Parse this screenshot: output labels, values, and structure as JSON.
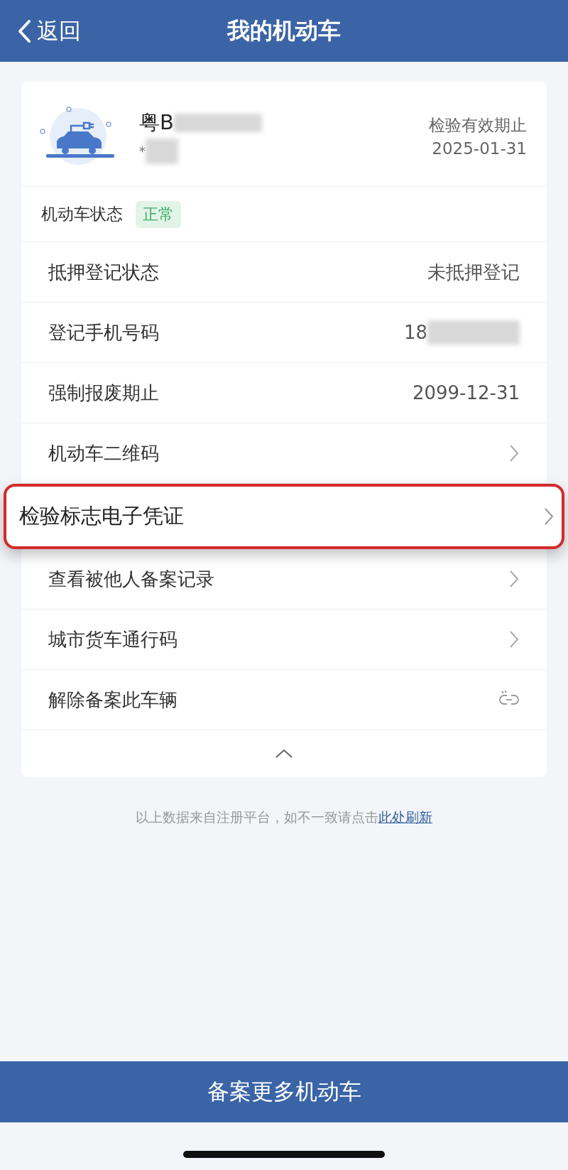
{
  "nav_bar": {
    "back": "返回",
    "title": "我的机动车"
  },
  "vehicle": {
    "plate": "粤B",
    "plate_line2": "*",
    "expiry_label": "检验有效期止",
    "expiry_date": "2025-01-31"
  },
  "status": {
    "label": "机动车状态",
    "badge": "正常"
  },
  "rows": [
    {
      "kind": "value",
      "label": "抵押登记状态",
      "value": "未抵押登记",
      "highlighted": false
    },
    {
      "kind": "masked",
      "label": "登记手机号码",
      "value": "18",
      "highlighted": false
    },
    {
      "kind": "value",
      "label": "强制报废期止",
      "value": "2099-12-31",
      "highlighted": false
    },
    {
      "kind": "link",
      "label": "机动车二维码",
      "highlighted": false
    },
    {
      "kind": "link",
      "label": "检验标志电子凭证",
      "highlighted": true
    },
    {
      "kind": "link",
      "label": "查看被他人备案记录",
      "highlighted": false
    },
    {
      "kind": "link",
      "label": "城市货车通行码",
      "highlighted": false
    },
    {
      "kind": "unlink",
      "label": "解除备案此车辆",
      "highlighted": false
    }
  ],
  "footer": {
    "note": "以上数据来自注册平台，如不一致请点击",
    "link": "此处刷新"
  },
  "bottom_button": "备案更多机动车"
}
